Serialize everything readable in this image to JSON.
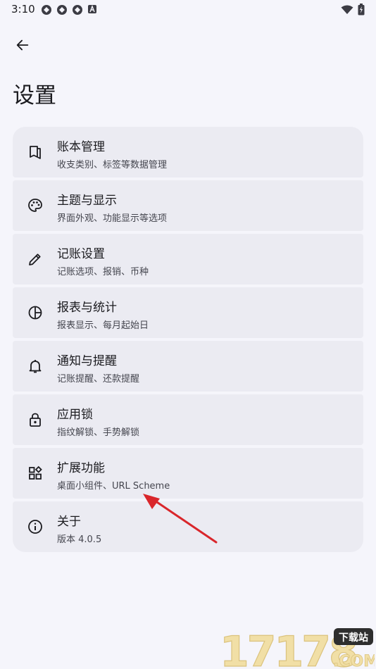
{
  "status_bar": {
    "time": "3:10",
    "icons": [
      "notification-icon",
      "notification-icon",
      "notification-icon",
      "a-icon"
    ],
    "right_icons": [
      "wifi-icon",
      "battery-icon"
    ]
  },
  "header": {
    "back_icon": "arrow-left-icon",
    "title": "设置"
  },
  "settings": [
    {
      "icon": "book-icon",
      "title": "账本管理",
      "subtitle": "收支类别、标签等数据管理"
    },
    {
      "icon": "palette-icon",
      "title": "主题与显示",
      "subtitle": "界面外观、功能显示等选项"
    },
    {
      "icon": "pencil-icon",
      "title": "记账设置",
      "subtitle": "记账选项、报销、币种"
    },
    {
      "icon": "pie-chart-icon",
      "title": "报表与统计",
      "subtitle": "报表显示、每月起始日"
    },
    {
      "icon": "bell-icon",
      "title": "通知与提醒",
      "subtitle": "记账提醒、还款提醒"
    },
    {
      "icon": "lock-icon",
      "title": "应用锁",
      "subtitle": "指纹解锁、手势解锁"
    },
    {
      "icon": "widgets-icon",
      "title": "扩展功能",
      "subtitle": "桌面小组件、URL Scheme"
    },
    {
      "icon": "info-icon",
      "title": "关于",
      "subtitle": "版本 4.0.5"
    }
  ],
  "watermark": {
    "number": "17178",
    "tag": "下载站",
    "domain": ".COM"
  },
  "colors": {
    "background": "#f5f5fb",
    "card": "#ebebf2",
    "text": "#1b1b1f",
    "subtext": "#45464f",
    "annotation_arrow": "#d9262b"
  }
}
